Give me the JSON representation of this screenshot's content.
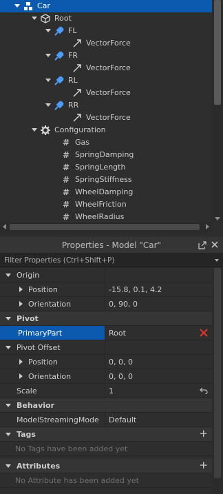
{
  "explorer": {
    "items": [
      {
        "label": "Car",
        "icon": "model-icon",
        "selected": true
      },
      {
        "label": "Root",
        "icon": "part-icon"
      },
      {
        "label": "FL",
        "icon": "attachment-icon"
      },
      {
        "label": "VectorForce",
        "icon": "vectorforce-icon"
      },
      {
        "label": "FR",
        "icon": "attachment-icon"
      },
      {
        "label": "VectorForce",
        "icon": "vectorforce-icon"
      },
      {
        "label": "RL",
        "icon": "attachment-icon"
      },
      {
        "label": "VectorForce",
        "icon": "vectorforce-icon"
      },
      {
        "label": "RR",
        "icon": "attachment-icon"
      },
      {
        "label": "VectorForce",
        "icon": "vectorforce-icon"
      },
      {
        "label": "Configuration",
        "icon": "gear-icon"
      },
      {
        "label": "Gas",
        "icon": "number-value-icon"
      },
      {
        "label": "SpringDamping",
        "icon": "number-value-icon"
      },
      {
        "label": "SpringLength",
        "icon": "number-value-icon"
      },
      {
        "label": "SpringStiffness",
        "icon": "number-value-icon"
      },
      {
        "label": "WheelDamping",
        "icon": "number-value-icon"
      },
      {
        "label": "WheelFriction",
        "icon": "number-value-icon"
      },
      {
        "label": "WheelRadius",
        "icon": "number-value-icon"
      }
    ]
  },
  "properties": {
    "title": "Properties - Model \"Car\"",
    "filter_placeholder": "Filter Properties (Ctrl+Shift+P)",
    "origin": {
      "label": "Origin",
      "position": {
        "label": "Position",
        "value": "-15.8, 0.1, 4.2"
      },
      "orientation": {
        "label": "Orientation",
        "value": "0, 90, 0"
      }
    },
    "pivot": {
      "label": "Pivot",
      "primary_part": {
        "label": "PrimaryPart",
        "value": "Root"
      },
      "pivot_offset": {
        "label": "Pivot Offset"
      },
      "position": {
        "label": "Position",
        "value": "0, 0, 0"
      },
      "orientation": {
        "label": "Orientation",
        "value": "0, 0, 0"
      },
      "scale": {
        "label": "Scale",
        "value": "1"
      }
    },
    "behavior": {
      "label": "Behavior",
      "model_streaming_mode": {
        "label": "ModelStreamingMode",
        "value": "Default"
      }
    },
    "tags": {
      "label": "Tags",
      "empty": "No Tags have been added yet"
    },
    "attributes": {
      "label": "Attributes",
      "empty": "No Attribute has been added yet"
    }
  },
  "colors": {
    "selection": "#0b5aaf",
    "panel_bg": "#2e2e2e",
    "category_bg": "#353535",
    "attachment_blue": "#4a9dff",
    "clear_red": "#e0362a"
  }
}
